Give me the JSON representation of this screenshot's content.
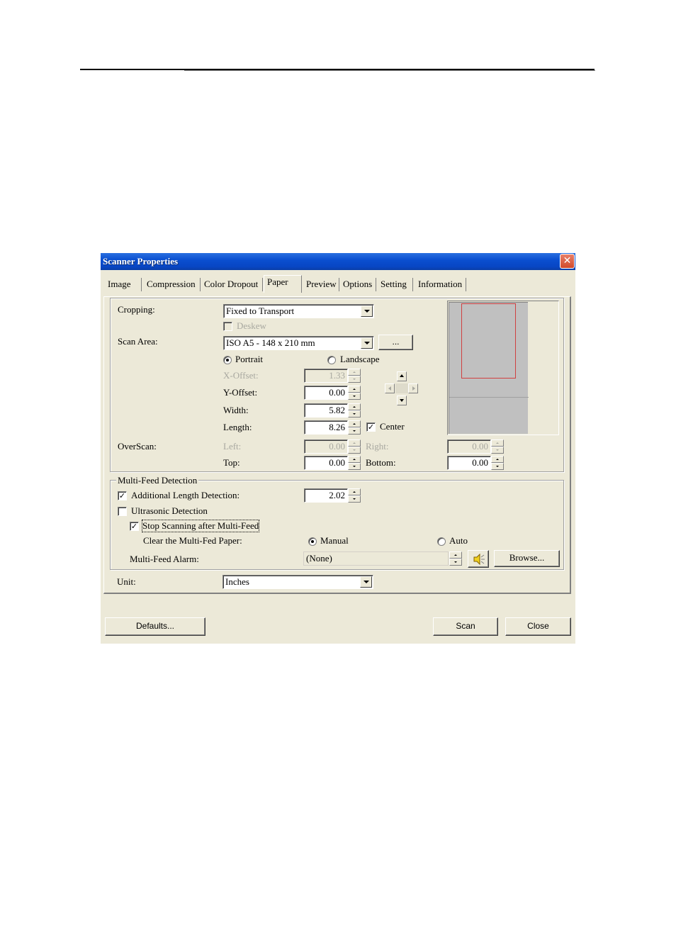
{
  "window": {
    "title": "Scanner Properties",
    "close_icon": "close-icon"
  },
  "tabs": [
    {
      "label": "Image",
      "active": false
    },
    {
      "label": "Compression",
      "active": false
    },
    {
      "label": "Color Dropout",
      "active": false
    },
    {
      "label": "Paper",
      "active": true
    },
    {
      "label": "Preview",
      "active": false
    },
    {
      "label": "Options",
      "active": false
    },
    {
      "label": "Setting",
      "active": false
    },
    {
      "label": "Information",
      "active": false
    }
  ],
  "paper": {
    "cropping_label": "Cropping:",
    "cropping_value": "Fixed to Transport",
    "deskew_label": "Deskew",
    "deskew_checked": false,
    "scan_area_label": "Scan Area:",
    "scan_area_value": "ISO A5 - 148 x 210 mm",
    "scan_area_more_label": "...",
    "orientation": {
      "portrait_label": "Portrait",
      "landscape_label": "Landscape",
      "selected": "Portrait"
    },
    "x_offset_label": "X-Offset:",
    "x_offset_value": "1.33",
    "y_offset_label": "Y-Offset:",
    "y_offset_value": "0.00",
    "width_label": "Width:",
    "width_value": "5.82",
    "length_label": "Length:",
    "length_value": "8.26",
    "center_label": "Center",
    "center_checked": true,
    "overscan_label": "OverScan:",
    "left_label": "Left:",
    "left_value": "0.00",
    "right_label": "Right:",
    "right_value": "0.00",
    "top_label": "Top:",
    "top_value": "0.00",
    "bottom_label": "Bottom:",
    "bottom_value": "0.00"
  },
  "multifeed": {
    "group_label": "Multi-Feed Detection",
    "additional_length_label": "Additional Length Detection:",
    "additional_length_checked": true,
    "additional_length_value": "2.02",
    "ultrasonic_label": "Ultrasonic Detection",
    "ultrasonic_checked": false,
    "stop_scanning_label": "Stop Scanning after Multi-Feed",
    "stop_scanning_checked": true,
    "clear_paper_label": "Clear the Multi-Fed Paper:",
    "manual_label": "Manual",
    "auto_label": "Auto",
    "clear_selected": "Manual",
    "alarm_label": "Multi-Feed Alarm:",
    "alarm_value": "(None)",
    "browse_label": "Browse..."
  },
  "unit": {
    "label": "Unit:",
    "value": "Inches"
  },
  "buttons": {
    "defaults": "Defaults...",
    "scan": "Scan",
    "close": "Close"
  },
  "colors": {
    "title_bar": "#0a4fd0",
    "dialog_bg": "#ece9d8",
    "scan_area_outline": "#d04040",
    "close_button": "#d24a2a"
  }
}
